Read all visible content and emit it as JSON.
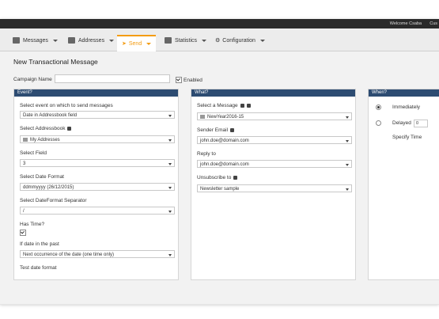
{
  "topbar": {
    "welcome": "Welcome Csaba",
    "cut": "Cus"
  },
  "nav": {
    "items": [
      {
        "label": "Messages"
      },
      {
        "label": "Addresses"
      },
      {
        "label": "Send"
      },
      {
        "label": "Statistics"
      },
      {
        "label": "Configuration"
      }
    ]
  },
  "page": {
    "title": "New Transactional Message"
  },
  "campaign": {
    "label": "Campaign Name",
    "value": "",
    "enabled_label": "Enabled"
  },
  "event": {
    "heading": "Event?",
    "select_event_label": "Select event on which to send messages",
    "select_event_value": "Date in Addressbook field",
    "addressbook_label": "Select Addressbook",
    "addressbook_value": "My Addresses",
    "field_label": "Select Field",
    "field_value": "3",
    "date_format_label": "Select Date Format",
    "date_format_value": "ddmmyyyy (26/12/2015)",
    "separator_label": "Select DateFormat Separator",
    "separator_value": "/",
    "has_time_label": "Has Time?",
    "past_label": "If date in the past",
    "past_value": "Next occurrence of the date (one time only)",
    "test_label": "Test date format"
  },
  "what": {
    "heading": "What?",
    "message_label": "Select a Message",
    "message_value": "NewYear2016-15",
    "sender_label": "Sender Email",
    "sender_value": "john.doe@domain.com",
    "reply_label": "Reply to",
    "reply_value": "john.doe@domain.com",
    "unsub_label": "Unsubscribe to",
    "unsub_value": "Newsletter sample"
  },
  "when": {
    "heading": "When?",
    "immediately_label": "Immediately",
    "delayed_label": "Delayed",
    "delayed_value": "0",
    "specify_label": "Specify Time"
  }
}
